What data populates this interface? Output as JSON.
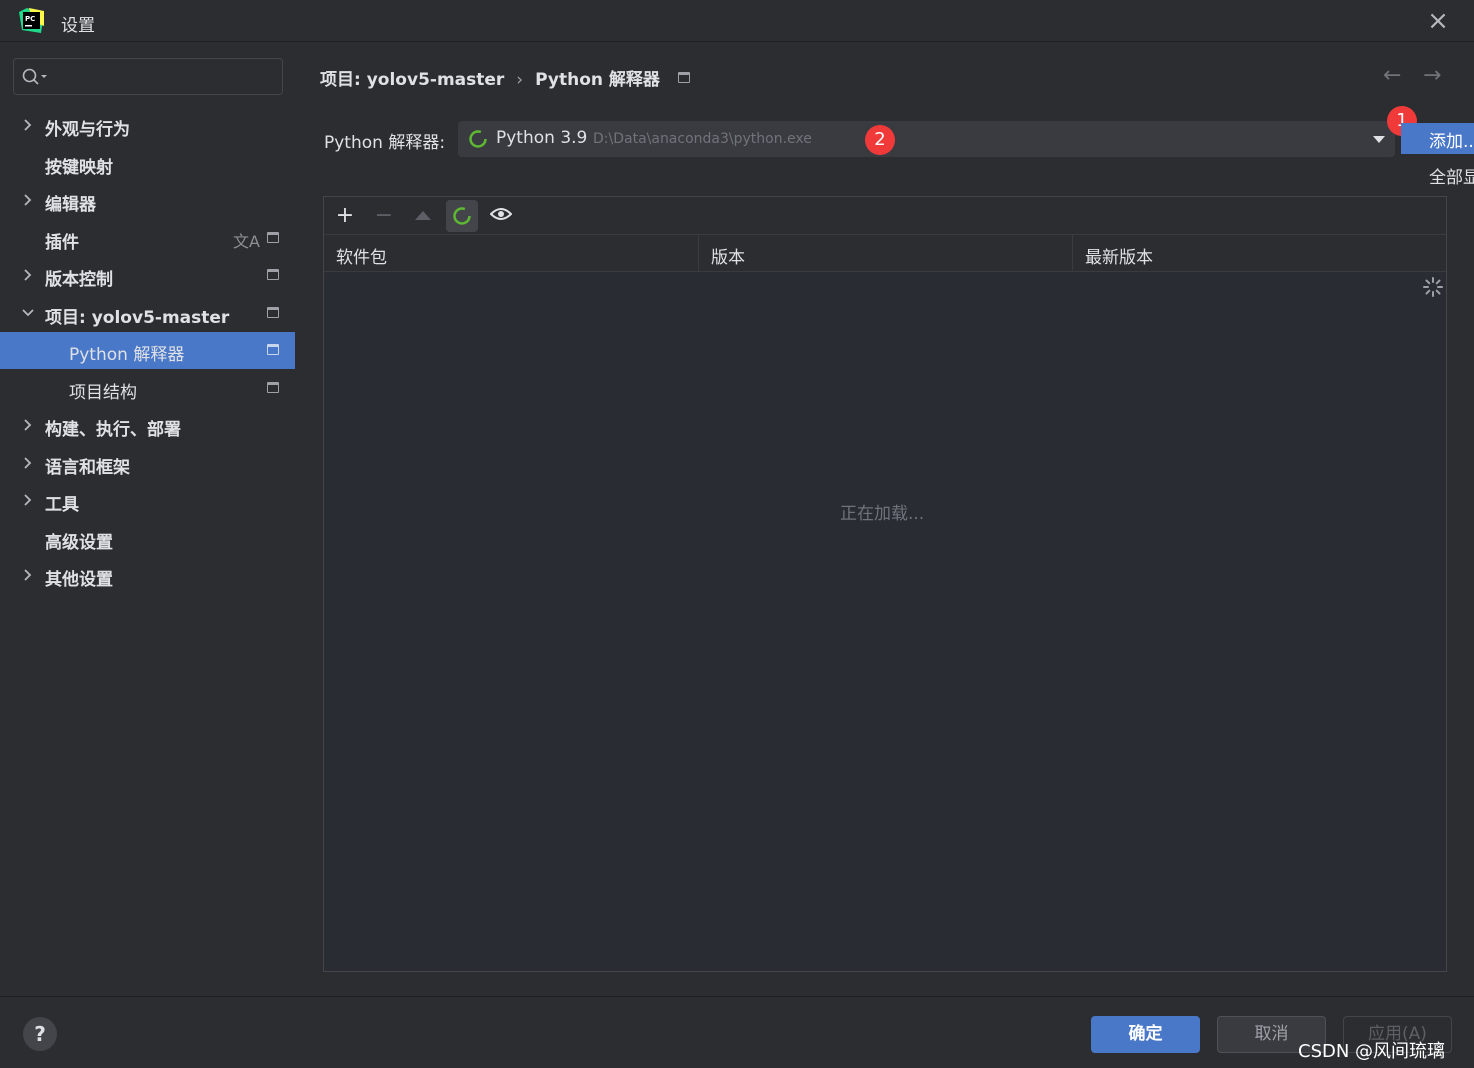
{
  "window": {
    "title": "设置",
    "close_icon": "close-icon"
  },
  "sidebar": {
    "search": {
      "value": "",
      "placeholder": ""
    },
    "items": [
      {
        "label": "外观与行为",
        "expandable": true,
        "expanded": false
      },
      {
        "label": "按键映射",
        "expandable": false
      },
      {
        "label": "编辑器",
        "expandable": true,
        "expanded": false
      },
      {
        "label": "插件",
        "expandable": false
      },
      {
        "label": "版本控制",
        "expandable": true,
        "expanded": false
      },
      {
        "label": "项目: yolov5-master",
        "expandable": true,
        "expanded": true
      },
      {
        "label": "Python 解释器",
        "child": true,
        "selected": true
      },
      {
        "label": "项目结构",
        "child": true
      },
      {
        "label": "构建、执行、部署",
        "expandable": true,
        "expanded": false
      },
      {
        "label": "语言和框架",
        "expandable": true,
        "expanded": false
      },
      {
        "label": "工具",
        "expandable": true,
        "expanded": false
      },
      {
        "label": "高级设置",
        "expandable": false
      },
      {
        "label": "其他设置",
        "expandable": true,
        "expanded": false
      }
    ]
  },
  "breadcrumb": {
    "parent": "项目: yolov5-master",
    "current": "Python 解释器"
  },
  "interpreter": {
    "label": "Python 解释器:",
    "name": "Python 3.9",
    "path": "D:\\Data\\anaconda3\\python.exe"
  },
  "badges": {
    "one": "1",
    "two": "2"
  },
  "actions": {
    "add": "添加...",
    "show_all": "全部显示..."
  },
  "packages": {
    "columns": [
      "软件包",
      "版本",
      "最新版本"
    ],
    "loading": "正在加载..."
  },
  "footer": {
    "help": "?",
    "ok": "确定",
    "cancel": "取消",
    "apply": "应用(A)",
    "watermark": "CSDN @风间琉璃"
  },
  "colors": {
    "accent": "#4a78c9",
    "badge": "#f03a3a",
    "background": "#2b2d30",
    "spinner": "#5fb832"
  }
}
